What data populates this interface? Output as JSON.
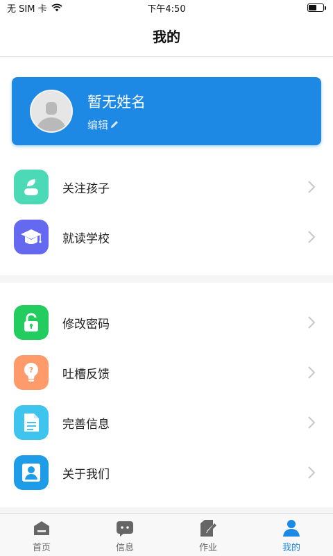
{
  "status_bar": {
    "carrier": "无 SIM 卡",
    "time": "下午4:50",
    "battery_level": 0.55
  },
  "header": {
    "title": "我的"
  },
  "profile": {
    "name": "暂无姓名",
    "edit_label": "编辑",
    "card_color": "#1e88e5",
    "avatar_icon": "person-placeholder-icon",
    "edit_icon": "pencil-icon"
  },
  "menu_section_1": [
    {
      "label": "关注孩子",
      "icon": "child-icon",
      "color": "#4cd9b5"
    },
    {
      "label": "就读学校",
      "icon": "graduation-cap-icon",
      "color": "#6469f0"
    }
  ],
  "menu_section_2": [
    {
      "label": "修改密码",
      "icon": "unlock-icon",
      "color": "#22cc5e"
    },
    {
      "label": "吐槽反馈",
      "icon": "lightbulb-icon",
      "color": "#ff9a6a"
    },
    {
      "label": "完善信息",
      "icon": "document-icon",
      "color": "#3fc4ee"
    },
    {
      "label": "关于我们",
      "icon": "user-icon",
      "color": "#1e9ce8"
    }
  ],
  "tab_bar": {
    "active_color": "#1e88e5",
    "inactive_color": "#666666",
    "tabs": [
      {
        "label": "首页",
        "icon": "home-icon",
        "active": false
      },
      {
        "label": "信息",
        "icon": "message-icon",
        "active": false
      },
      {
        "label": "作业",
        "icon": "homework-icon",
        "active": false
      },
      {
        "label": "我的",
        "icon": "profile-icon",
        "active": true
      }
    ]
  }
}
